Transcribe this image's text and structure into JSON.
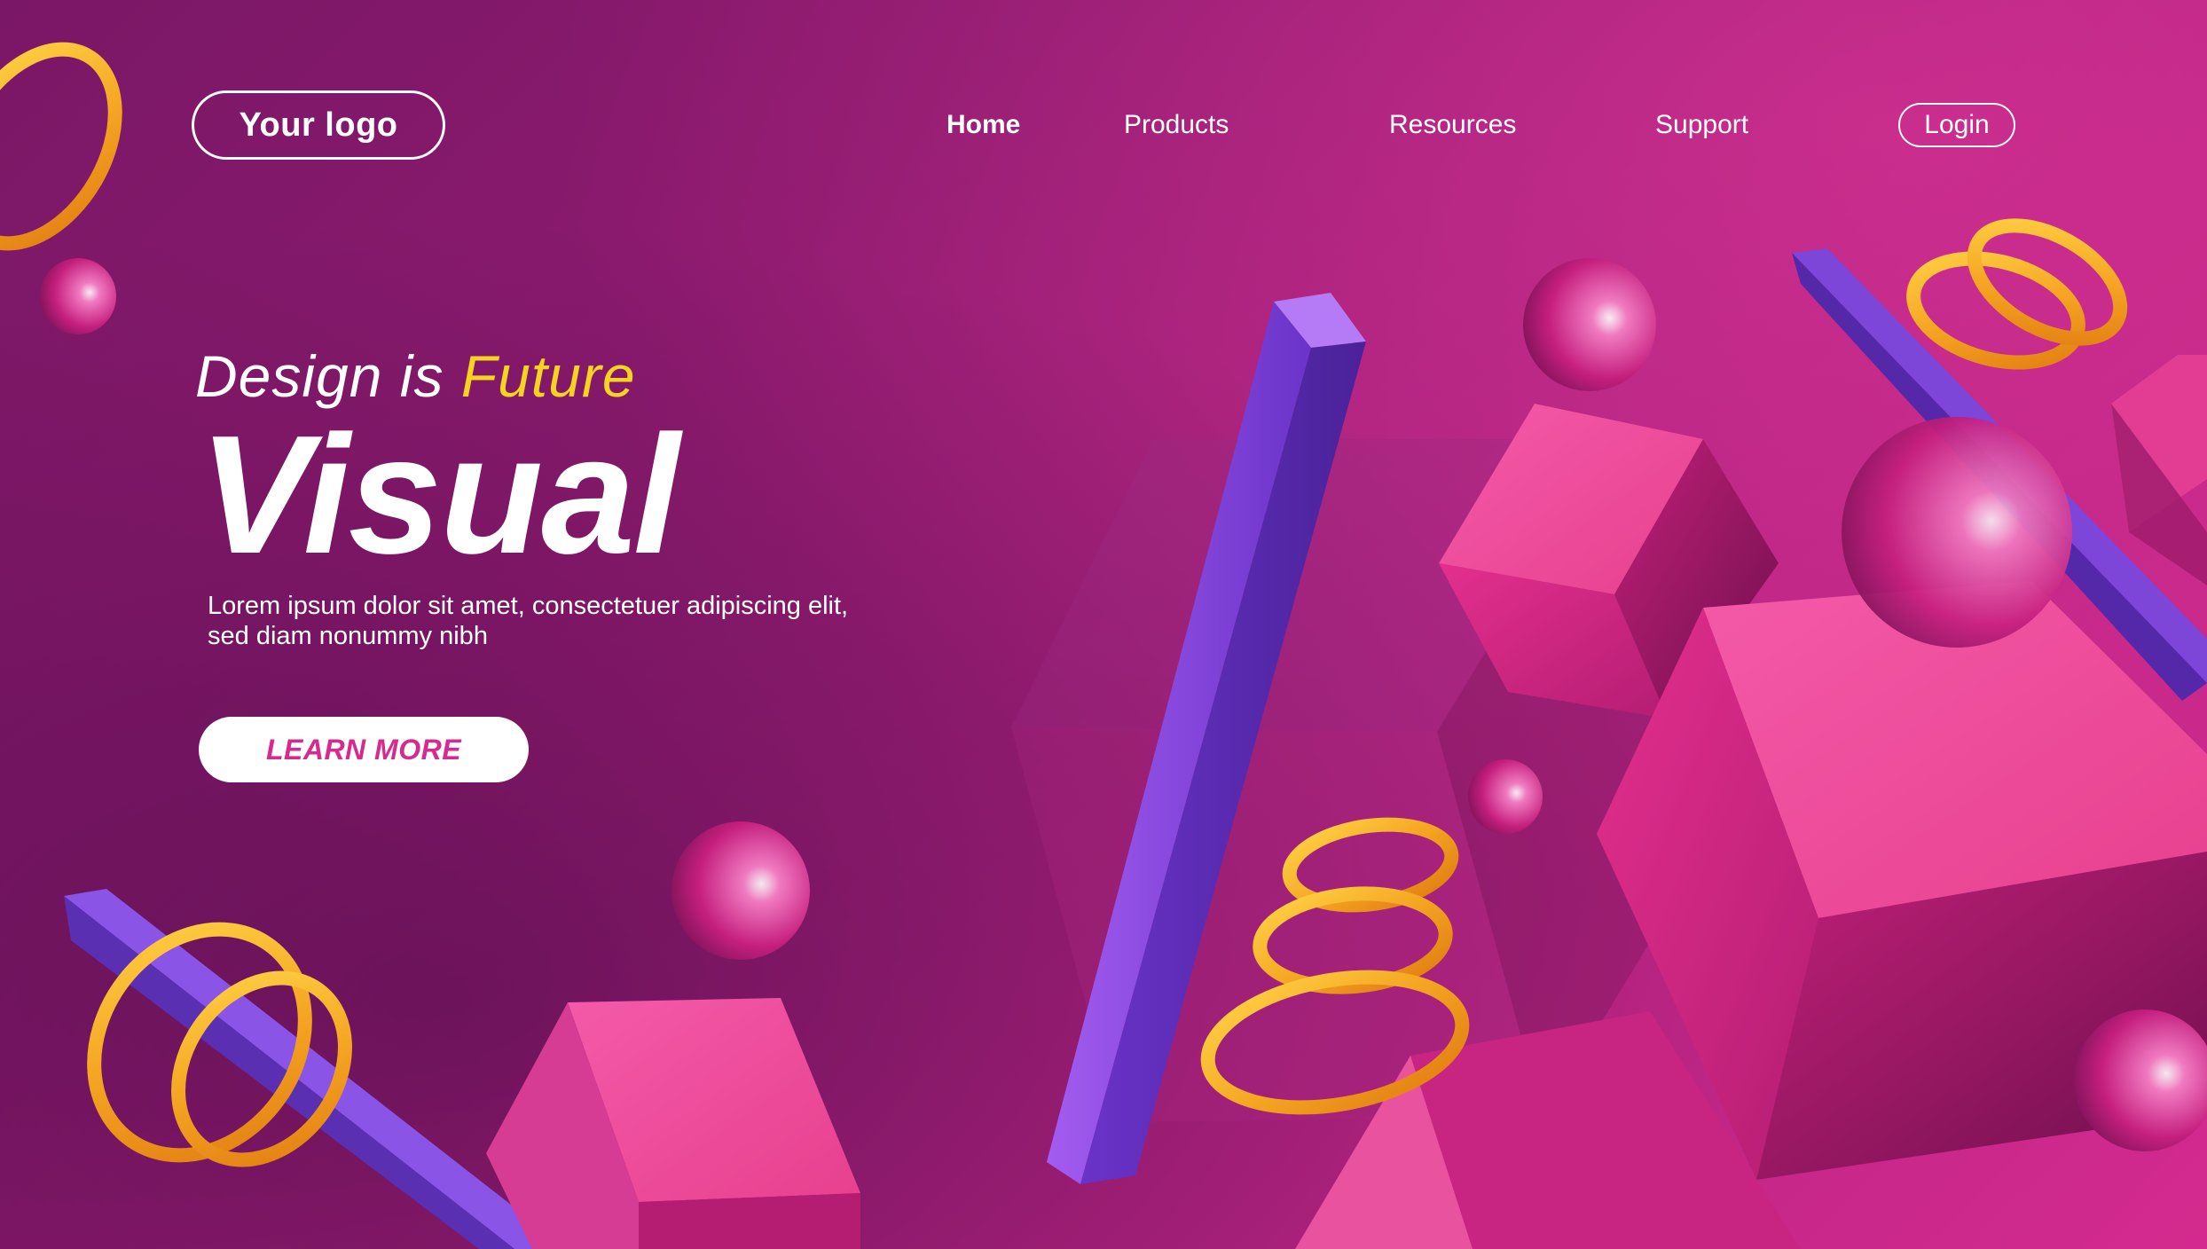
{
  "brand": {
    "logo_text": "Your logo"
  },
  "nav": {
    "items": [
      {
        "label": "Home",
        "active": true
      },
      {
        "label": "Products",
        "active": false
      },
      {
        "label": "Resources",
        "active": false
      },
      {
        "label": "Support",
        "active": false
      }
    ],
    "login_label": "Login"
  },
  "hero": {
    "tagline_prefix": "Design is ",
    "tagline_accent": "Future",
    "headline": "Visual",
    "body": "Lorem ipsum dolor sit amet, consectetuer adipiscing elit, sed diam nonummy nibh",
    "cta_label": "LEARN MORE"
  },
  "colors": {
    "background_start": "#7a1766",
    "background_end": "#d42a8f",
    "accent_yellow": "#f5d320",
    "cta_text": "#d62a8e",
    "cube_pink": "#f0479e",
    "bar_purple": "#8a4fe0",
    "ring_gold": "#f5a623"
  }
}
